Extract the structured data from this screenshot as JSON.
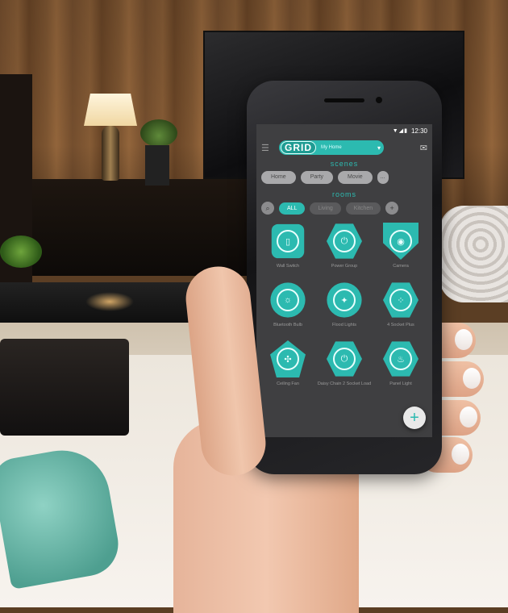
{
  "status_bar": {
    "time": "12:30",
    "icons": "▼◢▮"
  },
  "app_bar": {
    "logo": "GRID",
    "home_selector": "My Home",
    "chevron": "▾"
  },
  "scenes": {
    "label": "scenes",
    "items": [
      "Home",
      "Party",
      "Movie",
      "..."
    ]
  },
  "rooms": {
    "label": "rooms",
    "items": [
      "ALL",
      "Living",
      "Kitchen"
    ],
    "active": "ALL"
  },
  "devices": [
    {
      "label": "Wall Switch",
      "icon": "switch-icon"
    },
    {
      "label": "Power Group",
      "icon": "socket-icon"
    },
    {
      "label": "Camera",
      "icon": "camera-icon"
    },
    {
      "label": "Bluetooth Bulb",
      "icon": "bulb-icon"
    },
    {
      "label": "Flood Lights",
      "icon": "floodlight-icon"
    },
    {
      "label": "4 Socket Plus",
      "icon": "socket-icon"
    },
    {
      "label": "Ceiling Fan",
      "icon": "fan-icon"
    },
    {
      "label": "Daisy Chain 2 Socket Load",
      "icon": "socket-icon"
    },
    {
      "label": "Panel Light",
      "icon": "flame-icon"
    }
  ],
  "fab_label": "+",
  "colors": {
    "accent": "#2cbab0",
    "screen_bg": "#3f3f41"
  }
}
